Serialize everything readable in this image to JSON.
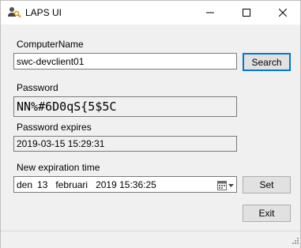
{
  "window": {
    "title": "LAPS UI",
    "app_icon": "user-key-icon"
  },
  "computer": {
    "label": "ComputerName",
    "value": "swc-devclient01",
    "search_label": "Search"
  },
  "password": {
    "label": "Password",
    "value": "NN%#6D0qS{5$5C"
  },
  "expires": {
    "label": "Password expires",
    "value": "2019-03-15 15:29:31"
  },
  "new_expiration": {
    "label": "New expiration time",
    "date_parts": {
      "weekday": "den",
      "day": "13",
      "month": "februari",
      "year_time": "2019 15:36:25"
    },
    "calendar_icon": "calendar-dropdown-icon",
    "set_label": "Set"
  },
  "exit_label": "Exit",
  "colors": {
    "accent": "#0078d7",
    "window_bg": "#f0f0f0",
    "button_bg": "#e1e1e1",
    "border": "#7a7a7a"
  }
}
